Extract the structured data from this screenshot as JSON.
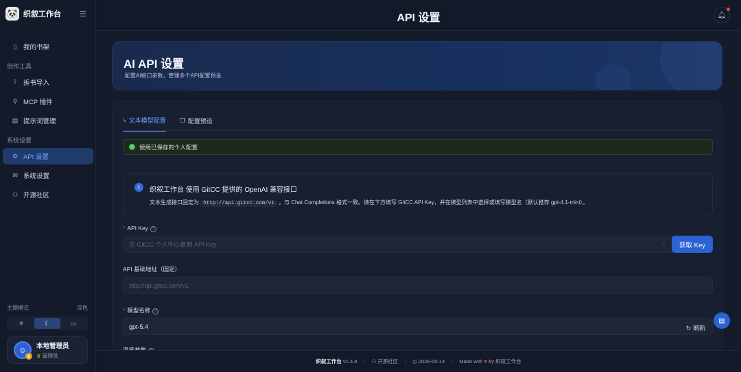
{
  "app": {
    "name": "织叙工作台"
  },
  "header": {
    "title": "API 设置"
  },
  "sidebar": {
    "items": [
      {
        "label": "我的书架",
        "icon": "book-icon"
      },
      {
        "group": "创作工具"
      },
      {
        "label": "拆书导入",
        "icon": "upload-icon"
      },
      {
        "label": "MCP 插件",
        "icon": "plug-icon"
      },
      {
        "label": "提示词管理",
        "icon": "prompt-icon"
      },
      {
        "group": "系统设置"
      },
      {
        "label": "API 设置",
        "icon": "gear-icon",
        "active": true
      },
      {
        "label": "系统设置",
        "icon": "mail-icon"
      },
      {
        "label": "开源社区",
        "icon": "community-icon"
      }
    ],
    "theme_label": "主题模式",
    "theme_value": "深色",
    "user": {
      "name": "本地管理员",
      "role": "管理员"
    }
  },
  "hero": {
    "title": "AI API 设置",
    "subtitle": "配置AI接口参数，管理多个API配置预设"
  },
  "tabs": [
    {
      "label": "文本模型配置",
      "active": true
    },
    {
      "label": "配置预设",
      "active": false
    }
  ],
  "alert": {
    "text": "使用已保存的个人配置"
  },
  "info": {
    "title": "织叙工作台 使用 GitCC 提供的 OpenAI 兼容接口",
    "desc_prefix": "文本生成接口固定为",
    "code": "http://api.gitcc.com/v1",
    "desc_suffix": "，与 Chat Completions 格式一致。请在下方填写 GitCC API Key，并在模型列表中选择或填写模型名（默认推荐 gpt-4.1-mini）。"
  },
  "form": {
    "api_key_label": "API Key",
    "api_key_placeholder": "在 GitCC 个人中心复制 API Key",
    "get_key_label": "获取 Key",
    "base_url_label": "API 基础地址（固定）",
    "base_url_value": "http://api.gitcc.com/v1",
    "model_label": "模型名称",
    "model_value": "gpt-5.4",
    "refresh_label": "刷新",
    "temp_label": "温度参数"
  },
  "footer": {
    "app": "织叙工作台",
    "version": "v1.4.8",
    "community": "开源社区",
    "date": "2026-05-14",
    "made_with": "Made with",
    "by": "by 织叙工作台"
  },
  "colors": {
    "accent": "#2b62d4",
    "active_bg": "#1f3b6b",
    "success": "#4fbf5b",
    "danger": "#e8453c"
  }
}
